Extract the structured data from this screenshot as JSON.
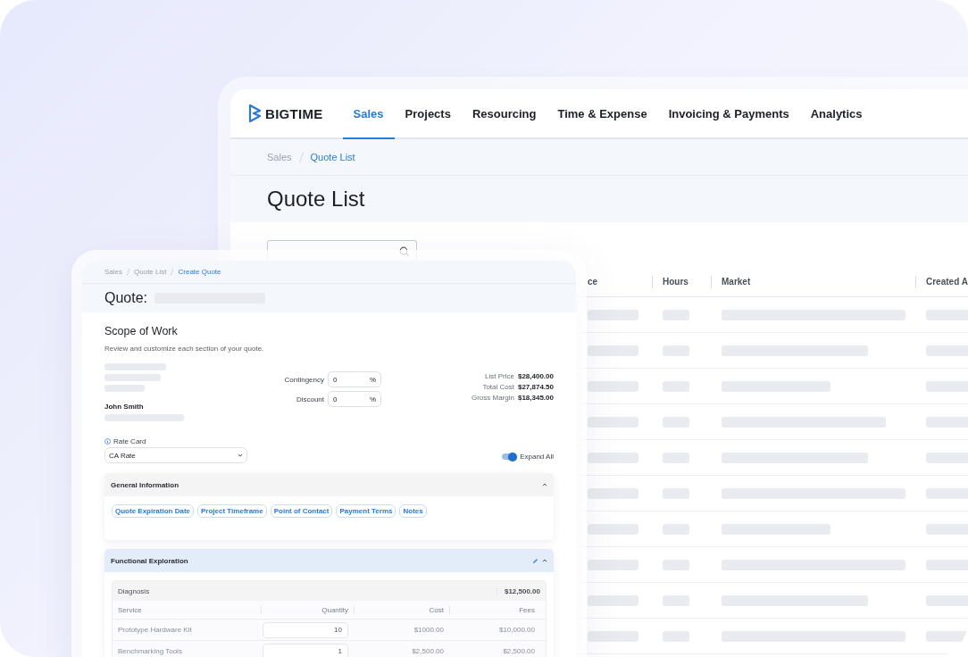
{
  "back_window": {
    "logo": "BIGTIME",
    "nav": [
      {
        "label": "Sales",
        "selected": true
      },
      {
        "label": "Projects",
        "selected": false
      },
      {
        "label": "Resourcing",
        "selected": false
      },
      {
        "label": "Time & Expense",
        "selected": false
      },
      {
        "label": "Invoicing & Payments",
        "selected": false
      },
      {
        "label": "Analytics",
        "selected": false
      }
    ],
    "breadcrumb": [
      {
        "label": "Sales",
        "current": false
      },
      {
        "label": "Quote List",
        "current": true
      }
    ],
    "title": "Quote List",
    "table": {
      "columns": [
        "ce",
        "Hours",
        "Market",
        "Created A"
      ]
    }
  },
  "front_window": {
    "breadcrumb": [
      {
        "label": "Sales",
        "current": false
      },
      {
        "label": "Quote List",
        "current": false
      },
      {
        "label": "Create Quote",
        "current": true
      }
    ],
    "title": "Quote:",
    "section_title": "Scope of Work",
    "description": "Review and customize each section of your quote.",
    "contact_name": "John Smith",
    "adjustments": [
      {
        "label": "Contingency",
        "value": "0",
        "unit": "%"
      },
      {
        "label": "Discount",
        "value": "0",
        "unit": "%"
      }
    ],
    "totals": [
      {
        "label": "List Price",
        "value": "$28,400.00"
      },
      {
        "label": "Total Cost",
        "value": "$27,874.50"
      },
      {
        "label": "Gross Margin",
        "value": "$18,345.00"
      }
    ],
    "rate_card": {
      "label": "Rate Card",
      "value": "CA Rate"
    },
    "expand_all": {
      "label": "Expand All",
      "on": true
    },
    "sections": [
      {
        "kind": "chips",
        "title": "General Information",
        "selected": false,
        "expanded": true,
        "chips": [
          "Quote Expiration Date",
          "Project Timeframe",
          "Point of Contact",
          "Payment Terms",
          "Notes"
        ]
      },
      {
        "kind": "services",
        "title": "Functional Exploration",
        "selected": true,
        "expanded": true,
        "group": {
          "title": "Diagnosis",
          "total": "$12,500.00",
          "columns": [
            "Service",
            "Quantity",
            "Cost",
            "Fees"
          ],
          "rows": [
            {
              "service": "Prototype Hardware Kit",
              "quantity": "10",
              "cost": "$1000.00",
              "fees": "$10,000.00"
            },
            {
              "service": "Benchmarking Tools",
              "quantity": "1",
              "cost": "$2,500.00",
              "fees": "$2,500.00"
            }
          ]
        }
      }
    ]
  }
}
